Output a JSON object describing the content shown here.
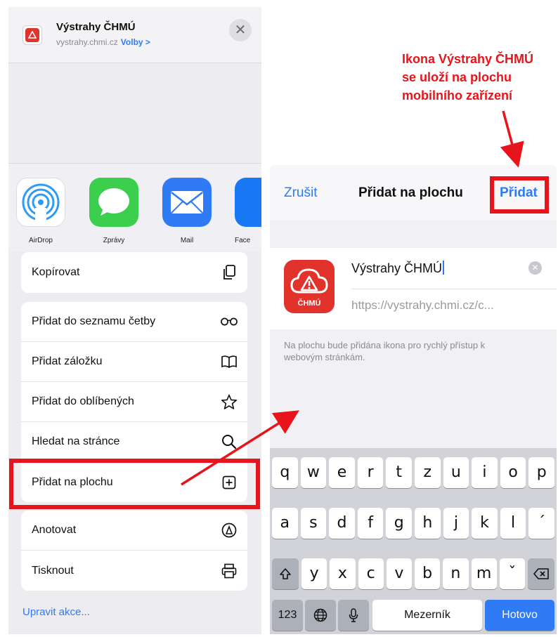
{
  "share_sheet": {
    "title": "Výstrahy ČHMÚ",
    "url": "vystrahy.chmi.cz",
    "options_link": "Volby >",
    "close_glyph": "✕",
    "apps": [
      {
        "label": "AirDrop",
        "icon": "airdrop-icon"
      },
      {
        "label": "Zprávy",
        "icon": "messages-icon"
      },
      {
        "label": "Mail",
        "icon": "mail-icon"
      },
      {
        "label": "Face",
        "icon": "facebook-icon"
      }
    ],
    "group1": [
      {
        "label": "Kopírovat",
        "icon": "copy-icon"
      }
    ],
    "group2": [
      {
        "label": "Přidat do seznamu četby",
        "icon": "glasses-icon"
      },
      {
        "label": "Přidat záložku",
        "icon": "book-icon"
      },
      {
        "label": "Přidat do oblíbených",
        "icon": "star-icon"
      },
      {
        "label": "Hledat na stránce",
        "icon": "search-icon"
      },
      {
        "label": "Přidat na plochu",
        "icon": "add-square-icon"
      }
    ],
    "group3": [
      {
        "label": "Anotovat",
        "icon": "markup-icon"
      },
      {
        "label": "Tisknout",
        "icon": "print-icon"
      }
    ],
    "edit_actions": "Upravit akce..."
  },
  "add_to_home": {
    "cancel": "Zrušit",
    "title": "Přidat na plochu",
    "add": "Přidat",
    "icon_label": "ČHMÚ",
    "name": "Výstrahy ČHMÚ",
    "url": "https://vystrahy.chmi.cz/c...",
    "info": "Na plochu bude přidána ikona pro rychlý přístup k webovým stránkám."
  },
  "keyboard": {
    "row1": [
      "q",
      "w",
      "e",
      "r",
      "t",
      "z",
      "u",
      "i",
      "o",
      "p"
    ],
    "row2": [
      "a",
      "s",
      "d",
      "f",
      "g",
      "h",
      "j",
      "k",
      "l",
      "´"
    ],
    "row3": [
      "y",
      "x",
      "c",
      "v",
      "b",
      "n",
      "m",
      "ˇ"
    ],
    "numbers": "123",
    "space": "Mezerník",
    "done": "Hotovo"
  },
  "annotation": {
    "lines": [
      "Ikona Výstrahy ČHMÚ",
      "se uloží na plochu",
      "mobilního zařízení"
    ]
  },
  "colors": {
    "highlight": "#e8141b",
    "accent": "#2f7bf5"
  }
}
